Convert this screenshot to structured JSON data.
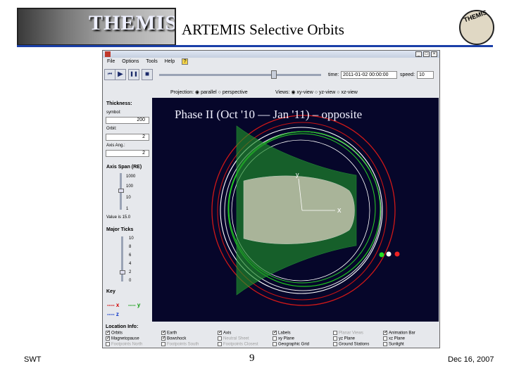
{
  "slide": {
    "title": "ARTEMIS Selective Orbits",
    "logo_left_text": "THEMIS",
    "logo_right_text": "THEMIS",
    "footer_left": "SWT",
    "footer_page": "9",
    "footer_right": "Dec 16, 2007",
    "accent": "#1a3fa8"
  },
  "app": {
    "menu": [
      "File",
      "Options",
      "Tools",
      "Help"
    ],
    "help_icon": "?",
    "window_buttons": [
      "_",
      "□",
      "×"
    ],
    "toolbar": {
      "buttons": [
        {
          "icon": "step-back-icon",
          "glyph": "⏮"
        },
        {
          "icon": "play-icon",
          "glyph": "▶"
        },
        {
          "icon": "pause-icon",
          "glyph": "❚❚"
        },
        {
          "icon": "stop-icon",
          "glyph": "■"
        }
      ],
      "time_label": "time:",
      "time_value": "2011-01-02 00:00:00",
      "speed_label": "speed:",
      "speed_value": "10",
      "time_progress": 0.71
    },
    "projection": {
      "label": "Projection:",
      "options": [
        "parallel",
        "perspective"
      ],
      "selected": "parallel"
    },
    "views": {
      "label": "Views:",
      "options": [
        "xy-view",
        "yz-view",
        "xz-view"
      ],
      "selected": "xy-view"
    },
    "left_panel": {
      "thickness_title": "Thickness:",
      "fields": [
        {
          "label": "symbol:",
          "value": "200"
        },
        {
          "label": "Orbit:",
          "value": "2"
        },
        {
          "label": "Axis Ang.:",
          "value": "2"
        }
      ],
      "axis_span_title": "Axis Span (RE)",
      "axis_span_ticks": [
        "1000",
        "100",
        "10",
        "1"
      ],
      "axis_span_value": "Value is 15.0",
      "major_ticks_title": "Major Ticks",
      "major_ticks": [
        "10",
        "8",
        "6",
        "4",
        "2",
        "0"
      ],
      "key_title": "Key",
      "key_x": "---- x",
      "key_y": "---- y",
      "key_z": "---- z"
    },
    "display": {
      "overlay_text": "Phase II (Oct '10 — Jan '11) – opposite",
      "axis_x": "x",
      "axis_y": "y",
      "background": "#06062a"
    },
    "location_info": {
      "title": "Location Info:",
      "columns": [
        [
          {
            "label": "Orbits",
            "on": true,
            "dim": false
          },
          {
            "label": "Magnetopause",
            "on": true,
            "dim": false
          },
          {
            "label": "Footpoints North",
            "on": false,
            "dim": true
          }
        ],
        [
          {
            "label": "Earth",
            "on": true,
            "dim": false
          },
          {
            "label": "Bowshock",
            "on": true,
            "dim": false
          },
          {
            "label": "Footpoints South",
            "on": false,
            "dim": true
          }
        ],
        [
          {
            "label": "Axis",
            "on": true,
            "dim": false
          },
          {
            "label": "Neutral Sheet",
            "on": false,
            "dim": true
          },
          {
            "label": "Footpoints Closest",
            "on": false,
            "dim": true
          }
        ],
        [
          {
            "label": "Labels",
            "on": true,
            "dim": false
          },
          {
            "label": "xy Plane",
            "on": false,
            "dim": false
          },
          {
            "label": "Geographic Grid",
            "on": false,
            "dim": false
          }
        ],
        [
          {
            "label": "Planar Views",
            "on": false,
            "dim": true
          },
          {
            "label": "yz Plane",
            "on": false,
            "dim": false
          },
          {
            "label": "Ground Stations",
            "on": false,
            "dim": false
          }
        ],
        [
          {
            "label": "Animation Bar",
            "on": true,
            "dim": false
          },
          {
            "label": "xz Plane",
            "on": false,
            "dim": false
          },
          {
            "label": "Sunlight",
            "on": false,
            "dim": false
          }
        ]
      ]
    }
  }
}
